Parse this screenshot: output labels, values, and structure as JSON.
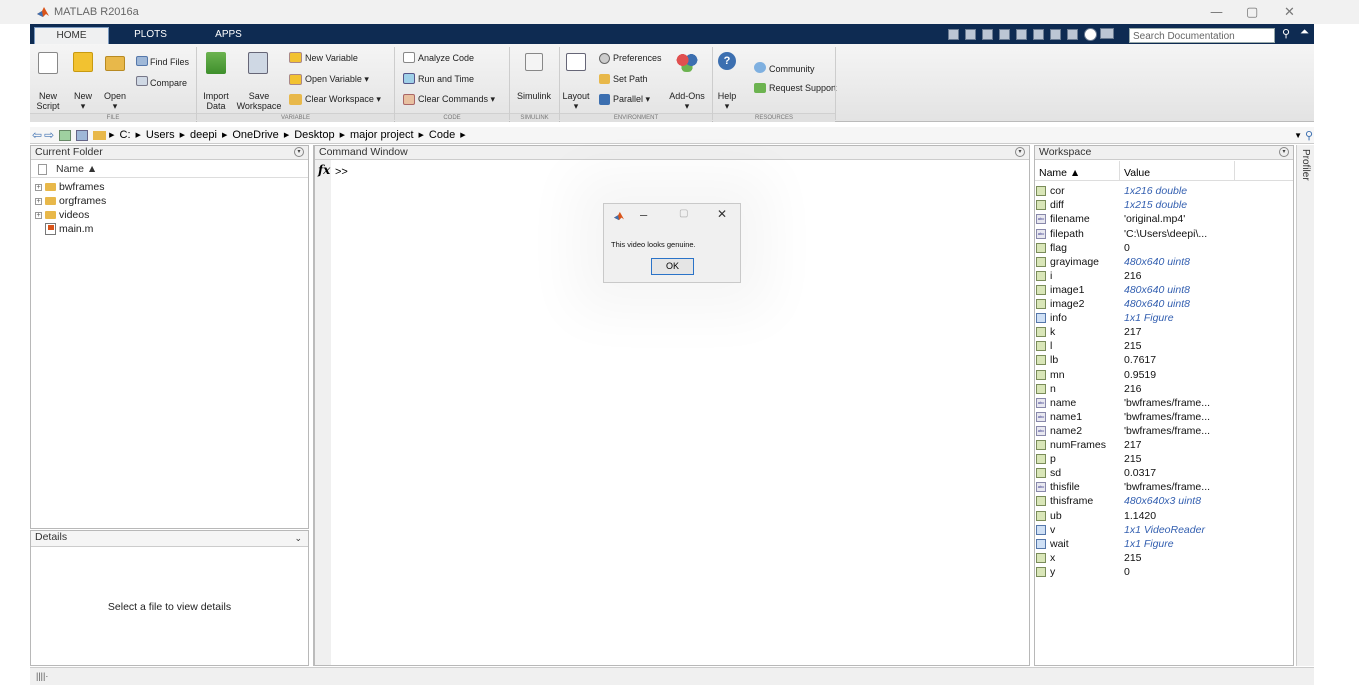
{
  "window": {
    "title": "MATLAB R2016a",
    "min": "—",
    "restore": "▢",
    "close": "✕"
  },
  "tabs": [
    "HOME",
    "PLOTS",
    "APPS"
  ],
  "search": {
    "placeholder": "Search Documentation"
  },
  "ribbon": {
    "file": {
      "new_script": [
        "New",
        "Script"
      ],
      "new": "New",
      "open": "Open",
      "find_files": "Find Files",
      "compare": "Compare",
      "group": "FILE"
    },
    "variable": {
      "import": [
        "Import",
        "Data"
      ],
      "save": [
        "Save",
        "Workspace"
      ],
      "new_variable": "New Variable",
      "open_variable": "Open Variable",
      "clear_workspace": "Clear Workspace",
      "group": "VARIABLE"
    },
    "code": {
      "analyze": "Analyze Code",
      "run_time": "Run and Time",
      "clear_commands": "Clear Commands",
      "group": "CODE"
    },
    "simulink": {
      "label": "Simulink",
      "group": "SIMULINK"
    },
    "environment": {
      "layout": "Layout",
      "preferences": "Preferences",
      "set_path": "Set Path",
      "parallel": "Parallel",
      "addons": "Add-Ons",
      "group": "ENVIRONMENT"
    },
    "resources": {
      "help": "Help",
      "community": "Community",
      "request_support": "Request Support",
      "group": "RESOURCES"
    }
  },
  "address": {
    "crumbs": [
      "C:",
      "Users",
      "deepi",
      "OneDrive",
      "Desktop",
      "major project",
      "Code"
    ]
  },
  "current_folder": {
    "title": "Current Folder",
    "col_name": "Name ▲",
    "items": [
      {
        "name": "bwframes",
        "type": "folder"
      },
      {
        "name": "orgframes",
        "type": "folder"
      },
      {
        "name": "videos",
        "type": "folder"
      },
      {
        "name": "main.m",
        "type": "file"
      }
    ]
  },
  "details": {
    "title": "Details",
    "message": "Select a file to view details"
  },
  "command_window": {
    "title": "Command Window",
    "fx": "fx",
    "prompt": ">>"
  },
  "dialog": {
    "message": "This video looks genuine.",
    "ok": "OK"
  },
  "workspace": {
    "title": "Workspace",
    "col_name": "Name ▲",
    "col_value": "Value",
    "vars": [
      {
        "name": "cor",
        "value": "1x216 double",
        "kind": "num",
        "italic": true
      },
      {
        "name": "diff",
        "value": "1x215 double",
        "kind": "num",
        "italic": true
      },
      {
        "name": "filename",
        "value": "'original.mp4'",
        "kind": "abc",
        "italic": false
      },
      {
        "name": "filepath",
        "value": "'C:\\Users\\deepi\\...",
        "kind": "abc",
        "italic": false
      },
      {
        "name": "flag",
        "value": "0",
        "kind": "num",
        "italic": false
      },
      {
        "name": "grayimage",
        "value": "480x640 uint8",
        "kind": "num",
        "italic": true
      },
      {
        "name": "i",
        "value": "216",
        "kind": "num",
        "italic": false
      },
      {
        "name": "image1",
        "value": "480x640 uint8",
        "kind": "num",
        "italic": true
      },
      {
        "name": "image2",
        "value": "480x640 uint8",
        "kind": "num",
        "italic": true
      },
      {
        "name": "info",
        "value": "1x1 Figure",
        "kind": "obj",
        "italic": true
      },
      {
        "name": "k",
        "value": "217",
        "kind": "num",
        "italic": false
      },
      {
        "name": "l",
        "value": "215",
        "kind": "num",
        "italic": false
      },
      {
        "name": "lb",
        "value": "0.7617",
        "kind": "num",
        "italic": false
      },
      {
        "name": "mn",
        "value": "0.9519",
        "kind": "num",
        "italic": false
      },
      {
        "name": "n",
        "value": "216",
        "kind": "num",
        "italic": false
      },
      {
        "name": "name",
        "value": "'bwframes/frame...",
        "kind": "abc",
        "italic": false
      },
      {
        "name": "name1",
        "value": "'bwframes/frame...",
        "kind": "abc",
        "italic": false
      },
      {
        "name": "name2",
        "value": "'bwframes/frame...",
        "kind": "abc",
        "italic": false
      },
      {
        "name": "numFrames",
        "value": "217",
        "kind": "num",
        "italic": false
      },
      {
        "name": "p",
        "value": "215",
        "kind": "num",
        "italic": false
      },
      {
        "name": "sd",
        "value": "0.0317",
        "kind": "num",
        "italic": false
      },
      {
        "name": "thisfile",
        "value": "'bwframes/frame...",
        "kind": "abc",
        "italic": false
      },
      {
        "name": "thisframe",
        "value": "480x640x3 uint8",
        "kind": "num",
        "italic": true
      },
      {
        "name": "ub",
        "value": "1.1420",
        "kind": "num",
        "italic": false
      },
      {
        "name": "v",
        "value": "1x1 VideoReader",
        "kind": "obj",
        "italic": true
      },
      {
        "name": "wait",
        "value": "1x1 Figure",
        "kind": "obj",
        "italic": true
      },
      {
        "name": "x",
        "value": "215",
        "kind": "num",
        "italic": false
      },
      {
        "name": "y",
        "value": "0",
        "kind": "num",
        "italic": false
      }
    ]
  },
  "profiler": {
    "label": "Profiler"
  },
  "colors": {
    "tabbar": "#0e2b52",
    "matlab_orange": "#d9541a",
    "link_blue": "#335fb0"
  }
}
